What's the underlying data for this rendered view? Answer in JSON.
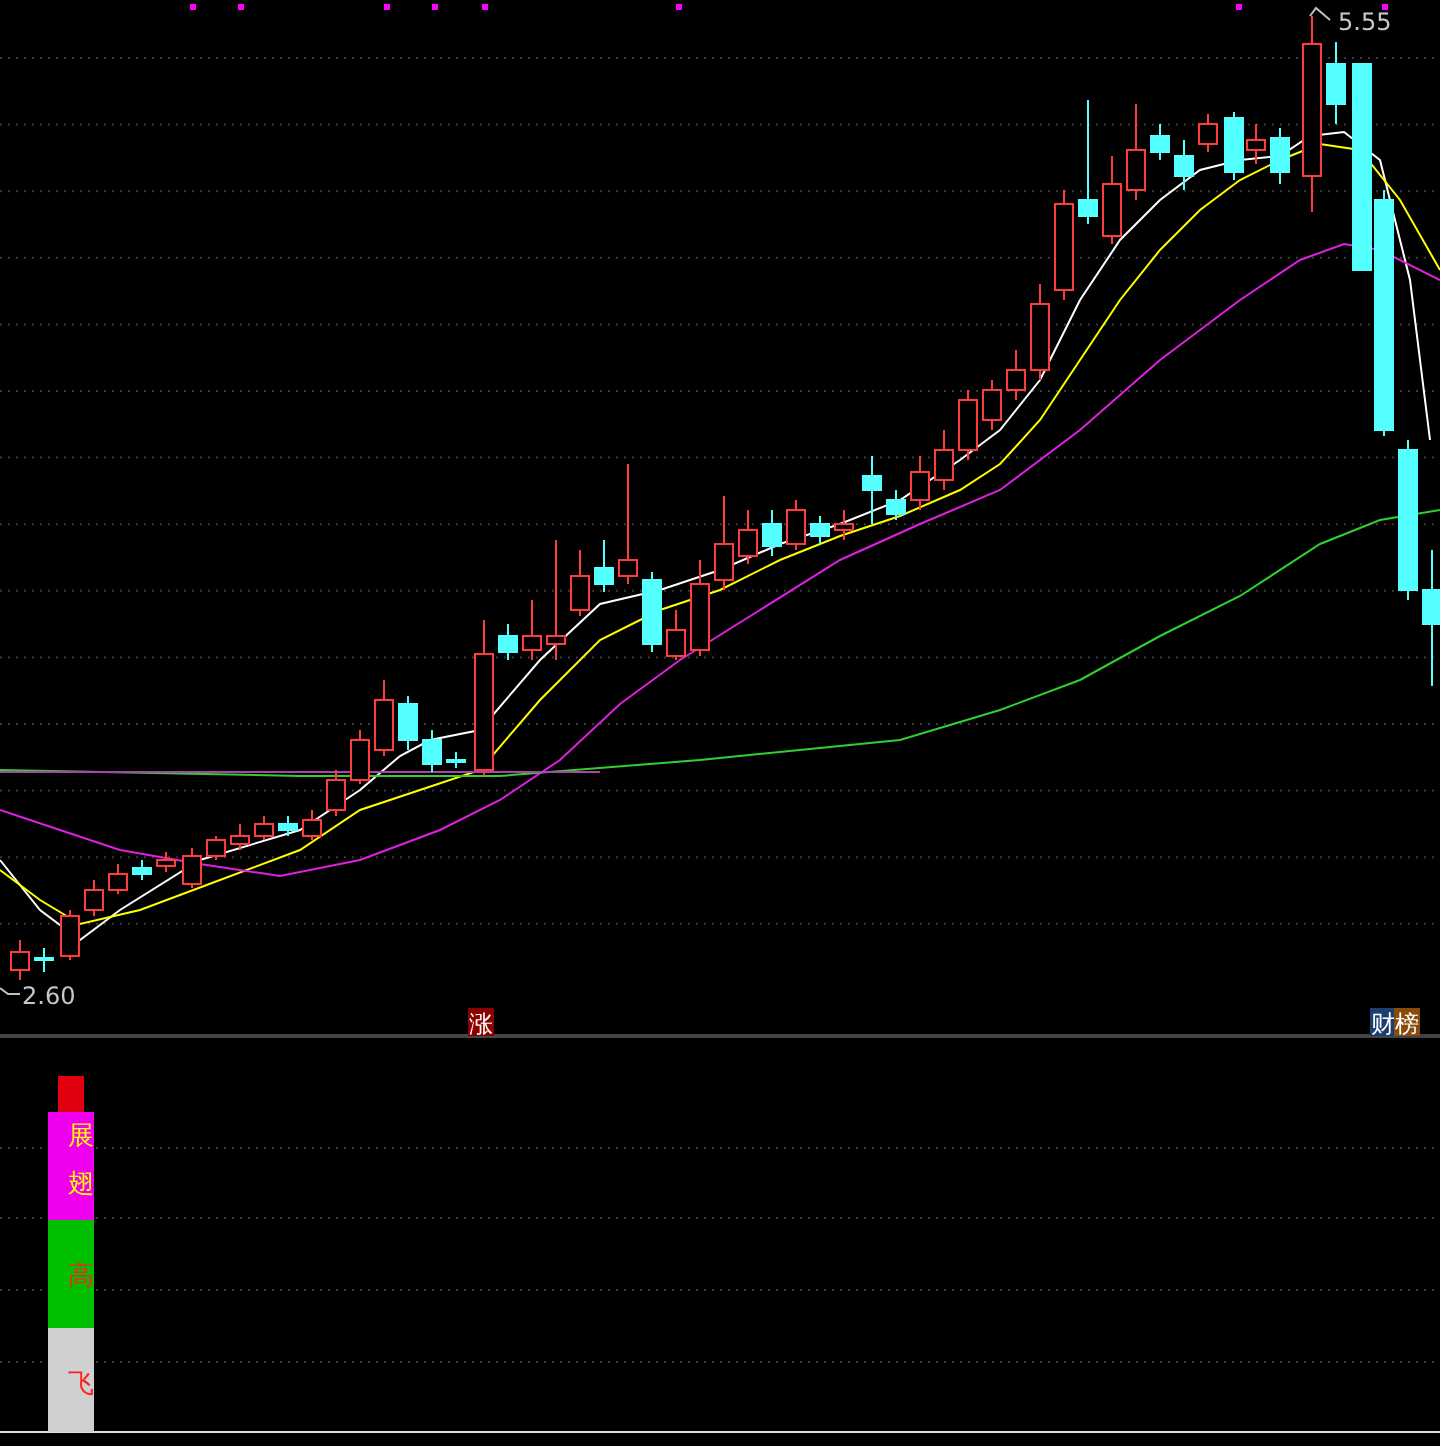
{
  "price_chart": {
    "high_label": "5.55",
    "low_label": "2.60"
  },
  "signals": [
    {
      "text": "涨",
      "color": "#8b0000"
    },
    {
      "text": "财",
      "color": "#1c3f6e"
    },
    {
      "text": "榜",
      "color": "#8a4a0c"
    }
  ],
  "indicator": {
    "segments": [
      {
        "color": "#ee00ee",
        "labels": [
          {
            "text": "展",
            "color": "#ffff00"
          },
          {
            "text": "翅",
            "color": "#ffff00"
          }
        ]
      },
      {
        "color": "#00c000",
        "labels": [
          {
            "text": "高",
            "color": "#ff2020"
          }
        ]
      },
      {
        "color": "#d0d0d0",
        "labels": [
          {
            "text": "飞",
            "color": "#ff2020"
          }
        ]
      }
    ]
  }
}
